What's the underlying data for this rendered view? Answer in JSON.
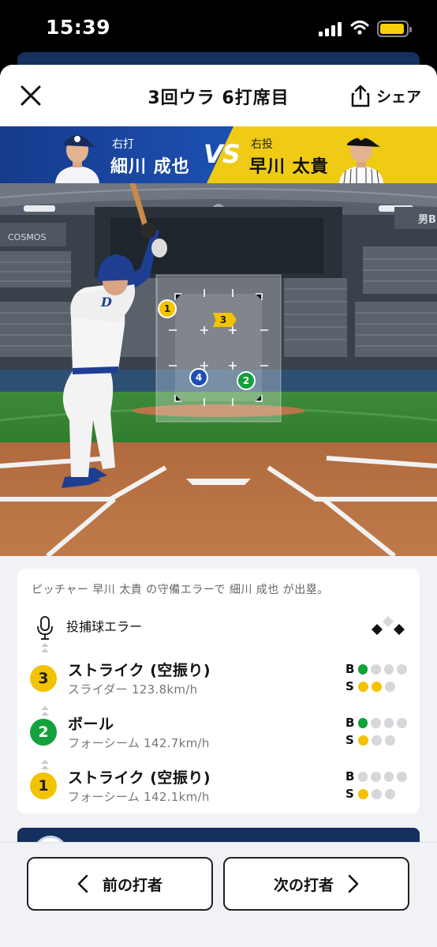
{
  "status_bar": {
    "time": "15:39"
  },
  "header": {
    "title": "3回ウラ 6打席目",
    "share_label": "シェア"
  },
  "matchup": {
    "batter": {
      "role": "右打",
      "name": "細川 成也"
    },
    "vs": "VS",
    "pitcher": {
      "role": "右投",
      "name": "早川 太貴"
    }
  },
  "field": {
    "pitch_markers": [
      {
        "number": "1",
        "color": "yellow"
      },
      {
        "number": "2",
        "color": "green"
      },
      {
        "number": "3",
        "color": "yellow"
      },
      {
        "number": "4",
        "color": "blue"
      }
    ],
    "stadium_sign": "COSMOS",
    "stadium_sign_right": "男B"
  },
  "play_card": {
    "summary": "ピッチャー 早川 太貴 の守備エラーで 細川 成也 が出塁。",
    "event": {
      "label": "投捕球エラー",
      "icon": "microphone-icon"
    },
    "pitches": [
      {
        "number": "3",
        "color": "yellow",
        "result": "ストライク (空振り)",
        "pitch_type": "スライダー",
        "speed": "123.8km/h",
        "balls": 1,
        "strikes": 2
      },
      {
        "number": "2",
        "color": "green",
        "result": "ボール",
        "pitch_type": "フォーシーム",
        "speed": "142.7km/h",
        "balls": 1,
        "strikes": 1
      },
      {
        "number": "1",
        "color": "yellow",
        "result": "ストライク (空振り)",
        "pitch_type": "フォーシーム",
        "speed": "142.1km/h",
        "balls": 0,
        "strikes": 1
      }
    ],
    "count_labels": {
      "balls": "B",
      "strikes": "S"
    }
  },
  "footer": {
    "prev_label": "前の打者",
    "next_label": "次の打者"
  },
  "colors": {
    "navy": "#15305e",
    "blue": "#1c4fb0",
    "yellow": "#efcb15",
    "green": "#12a13a",
    "ball_yellow": "#f3c300"
  }
}
